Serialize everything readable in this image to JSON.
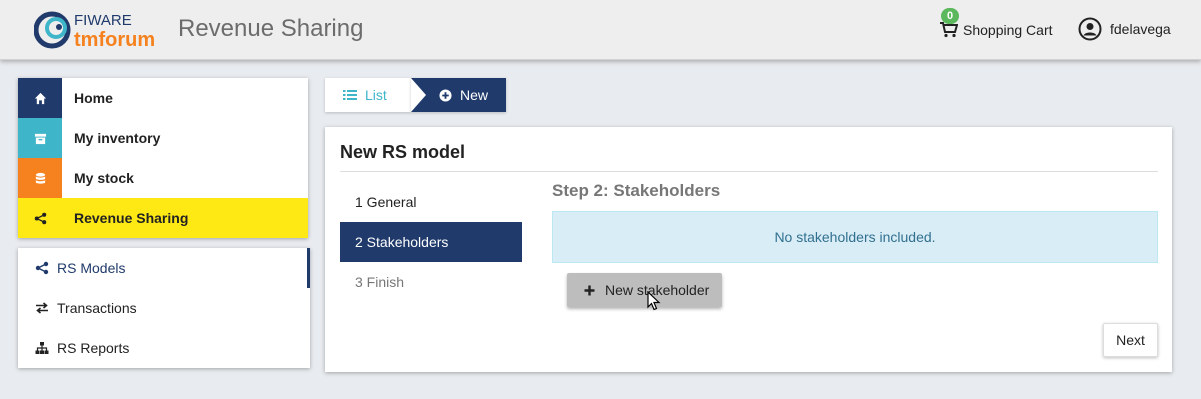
{
  "header": {
    "logo_top": "FIWARE",
    "logo_bottom": "tmforum",
    "app_title": "Revenue Sharing",
    "cart_count": "0",
    "cart_label": "Shopping Cart",
    "username": "fdelavega"
  },
  "sidebar": {
    "main_items": [
      {
        "label": "Home",
        "icon": "home-icon",
        "color": "#1f3a6b"
      },
      {
        "label": "My inventory",
        "icon": "archive-icon",
        "color": "#3fb5c9"
      },
      {
        "label": "My stock",
        "icon": "database-icon",
        "color": "#f5821f"
      },
      {
        "label": "Revenue Sharing",
        "icon": "share-icon",
        "color": "#ffe915",
        "active": true
      }
    ],
    "sub_items": [
      {
        "label": "RS Models",
        "icon": "share-icon",
        "active": true
      },
      {
        "label": "Transactions",
        "icon": "exchange-icon"
      },
      {
        "label": "RS Reports",
        "icon": "sitemap-icon"
      }
    ]
  },
  "breadcrumb": {
    "list_label": "List",
    "new_label": "New"
  },
  "panel": {
    "title": "New RS model",
    "steps": [
      {
        "label": "1 General",
        "state": "done"
      },
      {
        "label": "2 Stakeholders",
        "state": "active"
      },
      {
        "label": "3 Finish",
        "state": "todo"
      }
    ],
    "step_title": "Step 2: Stakeholders",
    "alert_text": "No stakeholders included.",
    "new_stakeholder_label": "New stakeholder",
    "next_label": "Next"
  },
  "colors": {
    "primary": "#1f3a6b",
    "accent_yellow": "#ffe915",
    "info_bg": "#d9edf7",
    "badge_green": "#5cb85c"
  }
}
